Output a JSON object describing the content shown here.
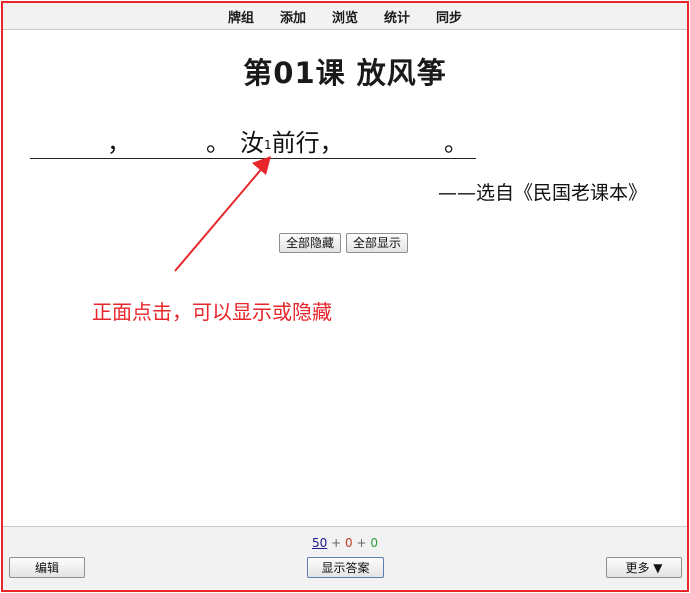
{
  "nav": {
    "items": [
      "牌组",
      "添加",
      "浏览",
      "统计",
      "同步"
    ]
  },
  "card": {
    "title": "第01课  放风筝",
    "comma1": "，",
    "period1": "。",
    "word": "汝",
    "sup": "1",
    "rest": "前行，",
    "period2": "。",
    "source": "——选自《民国老课本》"
  },
  "buttons": {
    "hide_all": "全部隐藏",
    "show_all": "全部显示"
  },
  "annotation": {
    "text": "正面点击，可以显示或隐藏",
    "color": "#e8262b"
  },
  "bottom": {
    "new_count": "50",
    "plus1": "+",
    "learn_count": "0",
    "plus2": "+",
    "review_count": "0",
    "edit_label": "编辑",
    "show_answer_label": "显示答案",
    "more_label": "更多 ▼"
  },
  "colors": {
    "accent": "#e8262b",
    "new": "#1a1a8c",
    "learn": "#c0392b",
    "review": "#2e9e3a"
  }
}
